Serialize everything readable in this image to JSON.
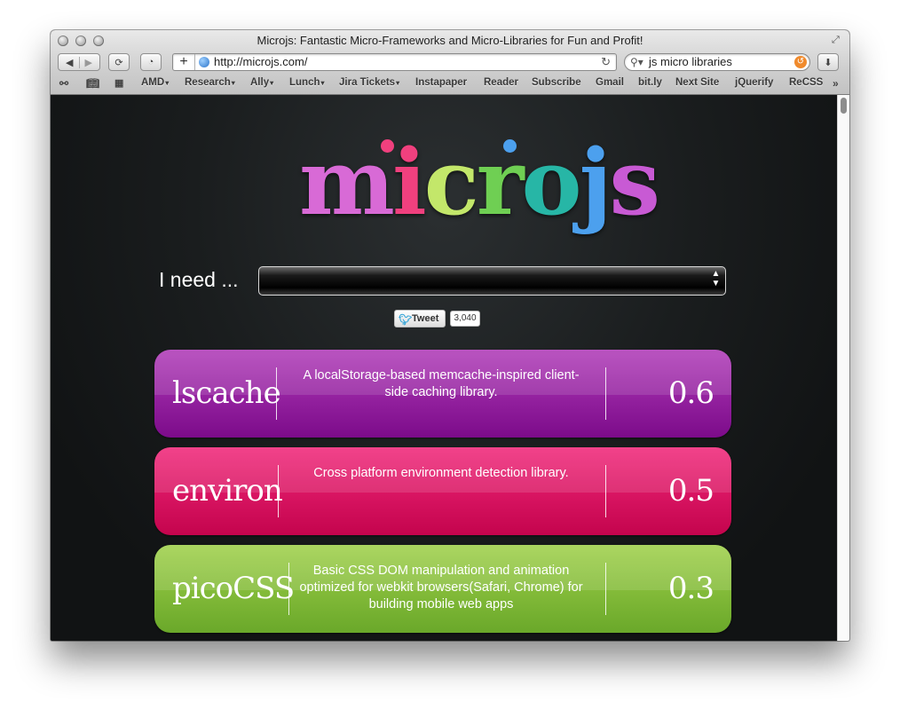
{
  "window": {
    "title": "Microjs: Fantastic Micro-Frameworks and Micro-Libraries for Fun and Profit!",
    "url": "http://microjs.com/",
    "search_query": "js micro libraries"
  },
  "bookmarks": [
    {
      "label": "AMD",
      "dropdown": true
    },
    {
      "label": "Research",
      "dropdown": true
    },
    {
      "label": "Ally",
      "dropdown": true
    },
    {
      "label": "Lunch",
      "dropdown": true
    },
    {
      "label": "Jira Tickets",
      "dropdown": true
    },
    {
      "label": "Instapaper",
      "dropdown": false
    },
    {
      "label": "Reader",
      "dropdown": false
    },
    {
      "label": "Subscribe",
      "dropdown": false
    },
    {
      "label": "Gmail",
      "dropdown": false
    },
    {
      "label": "bit.ly",
      "dropdown": false
    },
    {
      "label": "Next Site",
      "dropdown": false
    },
    {
      "label": "jQuerify",
      "dropdown": false
    },
    {
      "label": "ReCSS",
      "dropdown": false
    }
  ],
  "page": {
    "logo_letters": [
      {
        "char": "m",
        "color": "#d86ad6"
      },
      {
        "char": "i",
        "color": "#f0407e"
      },
      {
        "char": "c",
        "color": "#c3e76a"
      },
      {
        "char": "r",
        "color": "#6fcf53"
      },
      {
        "char": "o",
        "color": "#27b6a6"
      },
      {
        "char": "j",
        "color": "#4ca0ee"
      },
      {
        "char": "s",
        "color": "#c85ad4"
      }
    ],
    "need_label": "I need ...",
    "need_select_value": "",
    "tweet_label": "Tweet",
    "tweet_count": "3,040"
  },
  "libraries": [
    {
      "name": "lscache",
      "description": "A localStorage-based memcache-inspired client-side caching library.",
      "size": "0.6 kB",
      "color_top": "#b03cb8",
      "color_bottom": "#7c0b8a"
    },
    {
      "name": "environ",
      "description": "Cross platform environment detection library.",
      "size": "0.5 kB",
      "color_top": "#f0287a",
      "color_bottom": "#c4044d"
    },
    {
      "name": "picoCSS",
      "description": "Basic CSS DOM manipulation and animation optimized for webkit browsers(Safari, Chrome) for building mobile web apps",
      "size": "0.3 kB",
      "color_top": "#9fd04a",
      "color_bottom": "#6aa82a"
    }
  ]
}
